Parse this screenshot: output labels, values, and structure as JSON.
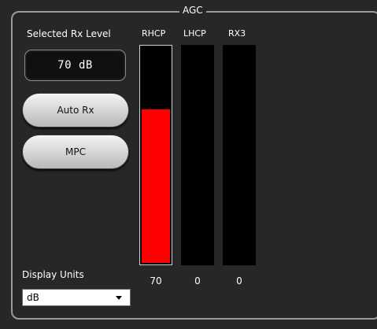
{
  "agc": {
    "title": "AGC",
    "selected_rx_level_label": "Selected Rx Level",
    "selected_rx_level_value": "70 dB",
    "buttons": {
      "auto_rx": "Auto Rx",
      "mpc": "MPC"
    },
    "meters": [
      {
        "label": "RHCP",
        "value": "70",
        "level_percent": 70,
        "color": "#ff0000"
      },
      {
        "label": "LHCP",
        "value": "0",
        "level_percent": 0,
        "color": "#ff0000"
      },
      {
        "label": "RX3",
        "value": "0",
        "level_percent": 0,
        "color": "#ff0000"
      }
    ],
    "display_units_label": "Display Units",
    "display_units_selected": "dB"
  }
}
